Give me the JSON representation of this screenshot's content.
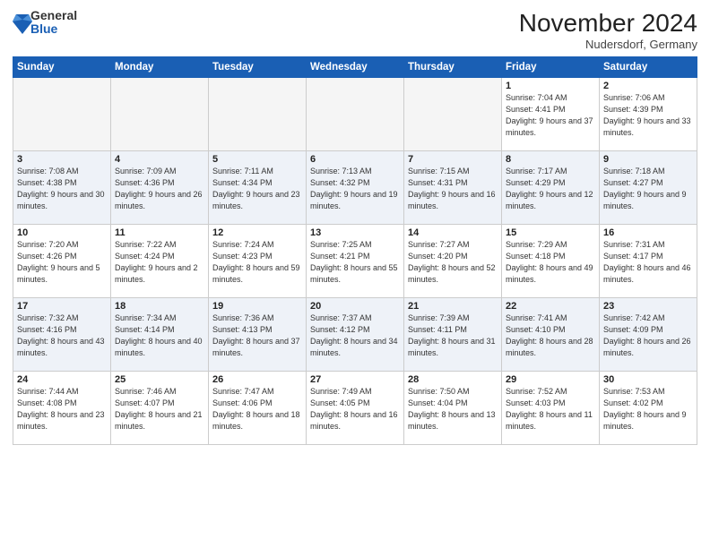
{
  "header": {
    "logo_general": "General",
    "logo_blue": "Blue",
    "month_title": "November 2024",
    "location": "Nudersdorf, Germany"
  },
  "weekdays": [
    "Sunday",
    "Monday",
    "Tuesday",
    "Wednesday",
    "Thursday",
    "Friday",
    "Saturday"
  ],
  "weeks": [
    [
      {
        "day": "",
        "info": ""
      },
      {
        "day": "",
        "info": ""
      },
      {
        "day": "",
        "info": ""
      },
      {
        "day": "",
        "info": ""
      },
      {
        "day": "",
        "info": ""
      },
      {
        "day": "1",
        "info": "Sunrise: 7:04 AM\nSunset: 4:41 PM\nDaylight: 9 hours\nand 37 minutes."
      },
      {
        "day": "2",
        "info": "Sunrise: 7:06 AM\nSunset: 4:39 PM\nDaylight: 9 hours\nand 33 minutes."
      }
    ],
    [
      {
        "day": "3",
        "info": "Sunrise: 7:08 AM\nSunset: 4:38 PM\nDaylight: 9 hours\nand 30 minutes."
      },
      {
        "day": "4",
        "info": "Sunrise: 7:09 AM\nSunset: 4:36 PM\nDaylight: 9 hours\nand 26 minutes."
      },
      {
        "day": "5",
        "info": "Sunrise: 7:11 AM\nSunset: 4:34 PM\nDaylight: 9 hours\nand 23 minutes."
      },
      {
        "day": "6",
        "info": "Sunrise: 7:13 AM\nSunset: 4:32 PM\nDaylight: 9 hours\nand 19 minutes."
      },
      {
        "day": "7",
        "info": "Sunrise: 7:15 AM\nSunset: 4:31 PM\nDaylight: 9 hours\nand 16 minutes."
      },
      {
        "day": "8",
        "info": "Sunrise: 7:17 AM\nSunset: 4:29 PM\nDaylight: 9 hours\nand 12 minutes."
      },
      {
        "day": "9",
        "info": "Sunrise: 7:18 AM\nSunset: 4:27 PM\nDaylight: 9 hours\nand 9 minutes."
      }
    ],
    [
      {
        "day": "10",
        "info": "Sunrise: 7:20 AM\nSunset: 4:26 PM\nDaylight: 9 hours\nand 5 minutes."
      },
      {
        "day": "11",
        "info": "Sunrise: 7:22 AM\nSunset: 4:24 PM\nDaylight: 9 hours\nand 2 minutes."
      },
      {
        "day": "12",
        "info": "Sunrise: 7:24 AM\nSunset: 4:23 PM\nDaylight: 8 hours\nand 59 minutes."
      },
      {
        "day": "13",
        "info": "Sunrise: 7:25 AM\nSunset: 4:21 PM\nDaylight: 8 hours\nand 55 minutes."
      },
      {
        "day": "14",
        "info": "Sunrise: 7:27 AM\nSunset: 4:20 PM\nDaylight: 8 hours\nand 52 minutes."
      },
      {
        "day": "15",
        "info": "Sunrise: 7:29 AM\nSunset: 4:18 PM\nDaylight: 8 hours\nand 49 minutes."
      },
      {
        "day": "16",
        "info": "Sunrise: 7:31 AM\nSunset: 4:17 PM\nDaylight: 8 hours\nand 46 minutes."
      }
    ],
    [
      {
        "day": "17",
        "info": "Sunrise: 7:32 AM\nSunset: 4:16 PM\nDaylight: 8 hours\nand 43 minutes."
      },
      {
        "day": "18",
        "info": "Sunrise: 7:34 AM\nSunset: 4:14 PM\nDaylight: 8 hours\nand 40 minutes."
      },
      {
        "day": "19",
        "info": "Sunrise: 7:36 AM\nSunset: 4:13 PM\nDaylight: 8 hours\nand 37 minutes."
      },
      {
        "day": "20",
        "info": "Sunrise: 7:37 AM\nSunset: 4:12 PM\nDaylight: 8 hours\nand 34 minutes."
      },
      {
        "day": "21",
        "info": "Sunrise: 7:39 AM\nSunset: 4:11 PM\nDaylight: 8 hours\nand 31 minutes."
      },
      {
        "day": "22",
        "info": "Sunrise: 7:41 AM\nSunset: 4:10 PM\nDaylight: 8 hours\nand 28 minutes."
      },
      {
        "day": "23",
        "info": "Sunrise: 7:42 AM\nSunset: 4:09 PM\nDaylight: 8 hours\nand 26 minutes."
      }
    ],
    [
      {
        "day": "24",
        "info": "Sunrise: 7:44 AM\nSunset: 4:08 PM\nDaylight: 8 hours\nand 23 minutes."
      },
      {
        "day": "25",
        "info": "Sunrise: 7:46 AM\nSunset: 4:07 PM\nDaylight: 8 hours\nand 21 minutes."
      },
      {
        "day": "26",
        "info": "Sunrise: 7:47 AM\nSunset: 4:06 PM\nDaylight: 8 hours\nand 18 minutes."
      },
      {
        "day": "27",
        "info": "Sunrise: 7:49 AM\nSunset: 4:05 PM\nDaylight: 8 hours\nand 16 minutes."
      },
      {
        "day": "28",
        "info": "Sunrise: 7:50 AM\nSunset: 4:04 PM\nDaylight: 8 hours\nand 13 minutes."
      },
      {
        "day": "29",
        "info": "Sunrise: 7:52 AM\nSunset: 4:03 PM\nDaylight: 8 hours\nand 11 minutes."
      },
      {
        "day": "30",
        "info": "Sunrise: 7:53 AM\nSunset: 4:02 PM\nDaylight: 8 hours\nand 9 minutes."
      }
    ]
  ]
}
